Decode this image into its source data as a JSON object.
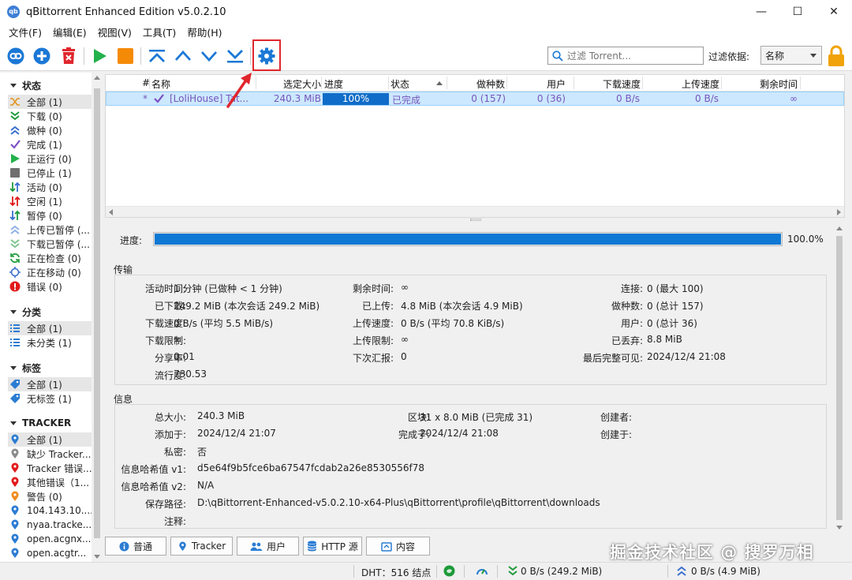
{
  "window": {
    "title": "qBittorrent Enhanced Edition v5.0.2.10",
    "minimize": "—",
    "maximize": "☐",
    "close": "✕"
  },
  "menu": [
    "文件(F)",
    "编辑(E)",
    "视图(V)",
    "工具(T)",
    "帮助(H)"
  ],
  "toolbar": {
    "buttons": [
      "link-icon",
      "add-icon",
      "delete-icon",
      "play-icon",
      "stop-icon",
      "move-top-icon",
      "move-up-icon",
      "move-down-icon",
      "move-bottom-icon",
      "settings-icon"
    ],
    "search_placeholder": "过滤 Torrent...",
    "filter_label": "过滤依据:",
    "filter_value": "名称"
  },
  "sidebar": {
    "status_header": "状态",
    "status_items": [
      {
        "label": "全部 (1)",
        "icon": "shuffle-icon"
      },
      {
        "label": "下载 (0)",
        "icon": "download-icon"
      },
      {
        "label": "做种 (0)",
        "icon": "seed-icon"
      },
      {
        "label": "完成 (1)",
        "icon": "check-icon"
      },
      {
        "label": "正运行 (0)",
        "icon": "play-icon"
      },
      {
        "label": "已停止 (1)",
        "icon": "stop-icon"
      },
      {
        "label": "活动 (0)",
        "icon": "active-icon"
      },
      {
        "label": "空闲 (1)",
        "icon": "idle-icon"
      },
      {
        "label": "暂停 (0)",
        "icon": "pause-icon"
      },
      {
        "label": "上传已暂停 (...",
        "icon": "upload-paused-icon"
      },
      {
        "label": "下载已暂停 (...",
        "icon": "download-paused-icon"
      },
      {
        "label": "正在检查 (0)",
        "icon": "checking-icon"
      },
      {
        "label": "正在移动 (0)",
        "icon": "moving-icon"
      },
      {
        "label": "错误 (0)",
        "icon": "error-icon"
      }
    ],
    "category_header": "分类",
    "category_items": [
      "全部 (1)",
      "未分类 (1)"
    ],
    "tag_header": "标签",
    "tag_items": [
      "全部 (1)",
      "无标签 (1)"
    ],
    "tracker_header": "TRACKER",
    "tracker_items": [
      {
        "label": "全部 (1)",
        "color": "#2b7cd3"
      },
      {
        "label": "缺少 Tracker...",
        "color": "#8a8a8a"
      },
      {
        "label": "Tracker 错误...",
        "color": "#e21a1a"
      },
      {
        "label": "其他错误（1...",
        "color": "#e21a1a"
      },
      {
        "label": "警告 (0)",
        "color": "#f08c1e"
      },
      {
        "label": "104.143.10....",
        "color": "#2b7cd3"
      },
      {
        "label": "nyaa.tracke...",
        "color": "#2b7cd3"
      },
      {
        "label": "open.acgnx...",
        "color": "#2b7cd3"
      },
      {
        "label": "open.acgtr...",
        "color": "#2b7cd3"
      }
    ]
  },
  "transfer_list": {
    "columns": [
      "#",
      "名称",
      "选定大小",
      "进度",
      "状态",
      "做种数",
      "用户",
      "下载速度",
      "上传速度",
      "剩余时间"
    ],
    "rows": [
      {
        "num": "*",
        "name": "[LoliHouse] Tat...",
        "size": "240.3 MiB",
        "progress_text": "100%",
        "progress": 1.0,
        "status": "已完成",
        "seeds": "0 (157)",
        "peers": "0 (36)",
        "dl_speed": "0 B/s",
        "ul_speed": "0 B/s",
        "eta": "∞"
      }
    ]
  },
  "properties": {
    "progress_label": "进度:",
    "progress_pct": "100.0%",
    "progress": 1.0,
    "transfer_title": "传输",
    "transfer": {
      "active_time_label": "活动时间:",
      "active_time": "1 分钟 (已做种 < 1 分钟)",
      "remaining_label": "剩余时间:",
      "remaining": "∞",
      "connections_label": "连接:",
      "connections": "0 (最大 100)",
      "downloaded_label": "已下载:",
      "downloaded": "249.2 MiB (本次会话 249.2 MiB)",
      "uploaded_label": "已上传:",
      "uploaded": "4.8 MiB (本次会话 4.9 MiB)",
      "seeds_label": "做种数:",
      "seeds": "0 (总计 157)",
      "dl_speed_label": "下载速度:",
      "dl_speed": "0 B/s (平均 5.5 MiB/s)",
      "ul_speed_label": "上传速度:",
      "ul_speed": "0 B/s (平均 70.8 KiB/s)",
      "peers_label": "用户:",
      "peers": "0 (总计 36)",
      "dl_limit_label": "下载限制:",
      "dl_limit": "∞",
      "ul_limit_label": "上传限制:",
      "ul_limit": "∞",
      "wasted_label": "已丢弃:",
      "wasted": "8.8 MiB",
      "ratio_label": "分享率:",
      "ratio": "0.01",
      "reannounce_label": "下次汇报:",
      "reannounce": "0",
      "last_seen_label": "最后完整可见:",
      "last_seen": "2024/12/4 21:08",
      "popularity_label": "流行度:",
      "popularity": "730.53"
    },
    "info_title": "信息",
    "info": {
      "total_size_label": "总大小:",
      "total_size": "240.3 MiB",
      "pieces_label": "区块:",
      "pieces": "31 x 8.0 MiB (已完成 31)",
      "created_by_label": "创建者:",
      "created_by": "",
      "added_on_label": "添加于:",
      "added_on": "2024/12/4 21:07",
      "completed_on_label": "完成于:",
      "completed_on": "2024/12/4 21:08",
      "created_on_label": "创建于:",
      "created_on": "",
      "private_label": "私密:",
      "private": "否",
      "hash_v1_label": "信息哈希值 v1:",
      "hash_v1": "d5e64f9b5fce6ba67547fcdab2a26e8530556f78",
      "hash_v2_label": "信息哈希值 v2:",
      "hash_v2": "N/A",
      "save_path_label": "保存路径:",
      "save_path": "D:\\qBittorrent-Enhanced-v5.0.2.10-x64-Plus\\qBittorrent\\profile\\qBittorrent\\downloads",
      "comment_label": "注释:",
      "comment": ""
    }
  },
  "tabs": [
    "普通",
    "Tracker",
    "用户",
    "HTTP 源",
    "内容"
  ],
  "statusbar": {
    "dht": "DHT：516 结点",
    "download": "0 B/s (249.2 MiB)",
    "upload": "0 B/s (4.9 MiB)"
  },
  "watermark": "掘金技术社区 @ 搜罗万相",
  "colors": {
    "accent_blue": "#0f78d4",
    "selection": "#cce8ff",
    "annotation_red": "#e0262d"
  }
}
